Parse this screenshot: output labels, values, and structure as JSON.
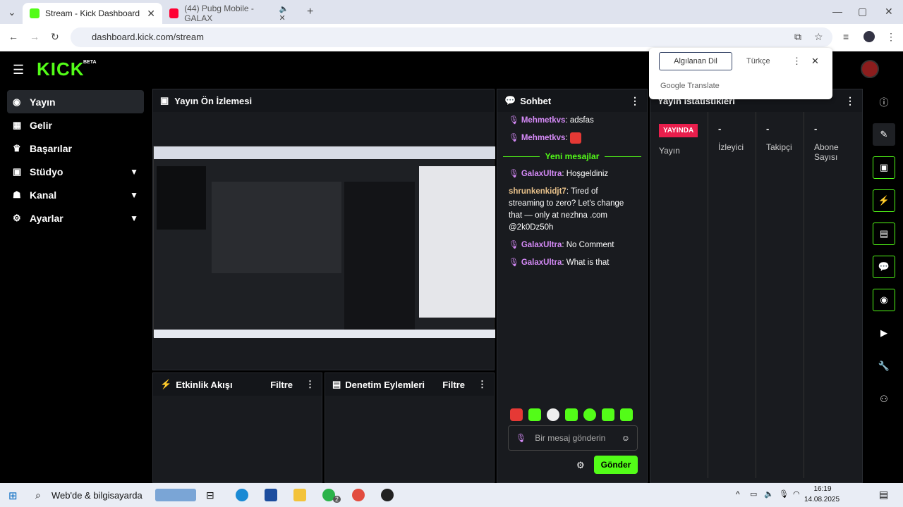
{
  "browser": {
    "tabs": [
      {
        "title": "Stream - Kick Dashboard"
      },
      {
        "title": "(44) Pubg Mobile - GALAX"
      }
    ],
    "url": "dashboard.kick.com/stream",
    "translate": {
      "detected": "Algılanan Dil",
      "target": "Türkçe",
      "brand": "Google Translate"
    }
  },
  "app": {
    "logo": "KICK",
    "beta": "BETA",
    "nav": [
      {
        "label": "Yayın"
      },
      {
        "label": "Gelir"
      },
      {
        "label": "Başarılar"
      },
      {
        "label": "Stüdyo"
      },
      {
        "label": "Kanal"
      },
      {
        "label": "Ayarlar"
      }
    ],
    "preview_title": "Yayın Ön İzlemesi",
    "chat": {
      "title": "Sohbet",
      "messages": [
        {
          "user": "Mehmetkvs",
          "text": ": adsfas"
        },
        {
          "user": "Mehmetkvs",
          "text": ":"
        },
        {
          "divider": "Yeni mesajlar"
        },
        {
          "user": "GalaxUltra",
          "text": ": Hoşgeldiniz"
        },
        {
          "user": "shrunkenkidjt7",
          "text": ": Tired of streaming to zero? Let's change that — only at nezhna .com @2k0Dz50h"
        },
        {
          "user": "GalaxUltra",
          "text": ": No Comment"
        },
        {
          "user": "GalaxUltra",
          "text": ": What is that"
        }
      ],
      "placeholder": "Bir mesaj gönderin",
      "send": "Gönder"
    },
    "stats": {
      "title": "Yayın İstatistikleri",
      "live": "YAYINDA",
      "cols": [
        {
          "label": "Yayın"
        },
        {
          "value": "-",
          "label": "İzleyici"
        },
        {
          "value": "-",
          "label": "Takipçi"
        },
        {
          "value": "-",
          "label": "Abone Sayısı"
        }
      ]
    },
    "activity": {
      "title": "Etkinlik Akışı",
      "filter": "Filtre"
    },
    "moderation": {
      "title": "Denetim Eylemleri",
      "filter": "Filtre"
    }
  },
  "taskbar": {
    "search": "Web'de & bilgisayarda",
    "time": "16:19",
    "date": "14.08.2025",
    "badge": "2"
  },
  "colors": {
    "accent": "#53fc18",
    "chat_user": "#d58af7",
    "live_badge": "#e91e4c"
  }
}
